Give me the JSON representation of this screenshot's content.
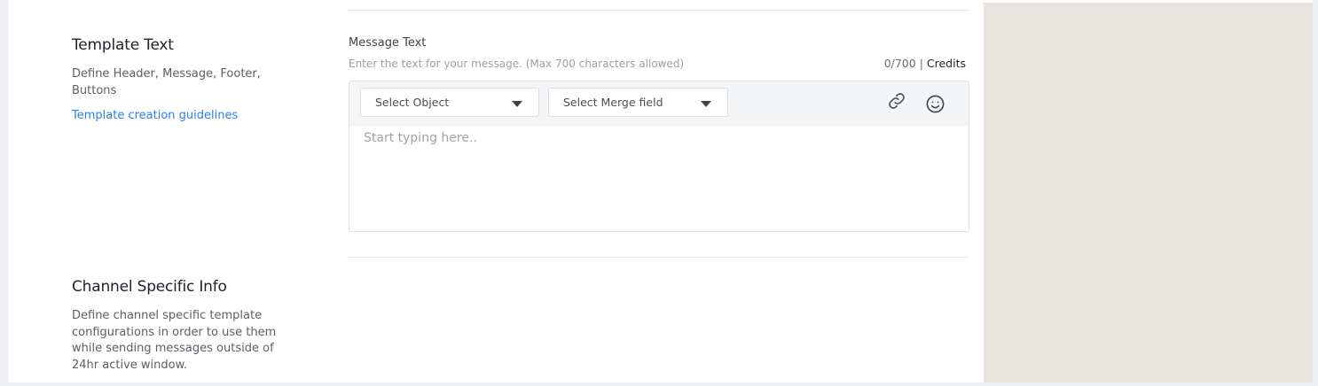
{
  "template_text": {
    "title": "Template Text",
    "description": "Define Header, Message, Footer, Buttons",
    "guidelines_link": "Template creation guidelines"
  },
  "message_text": {
    "label": "Message Text",
    "hint": "Enter the text for your message. (Max 700 characters allowed)",
    "char_count": "0/700",
    "separator": " | ",
    "credits_label": "Credits",
    "select_object": "Select Object",
    "select_merge_field": "Select Merge field",
    "link_icon": "link-icon",
    "emoji_icon": "smiley-icon",
    "value": "",
    "placeholder": "Start typing here.."
  },
  "channel_specific": {
    "title": "Channel Specific Info",
    "description": "Define channel specific template configurations in order to use them while sending messages outside of 24hr active window."
  },
  "colors": {
    "link": "#2b7de9",
    "preview_bg": "#e8e4e0",
    "toolbar_bg": "#f4f5f6"
  }
}
